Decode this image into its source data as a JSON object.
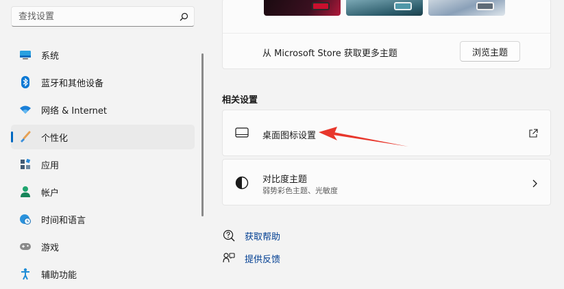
{
  "search": {
    "placeholder": "查找设置",
    "icon": "search-icon"
  },
  "sidebar": {
    "items": [
      {
        "label": "系统",
        "icon": "system-monitor-icon",
        "color": "#0078d4"
      },
      {
        "label": "蓝牙和其他设备",
        "icon": "bluetooth-icon",
        "color": "#0078d4"
      },
      {
        "label": "网络 & Internet",
        "icon": "wifi-icon",
        "color": "#0078d4"
      },
      {
        "label": "个性化",
        "icon": "brush-icon",
        "color": "#e0843c",
        "selected": true
      },
      {
        "label": "应用",
        "icon": "apps-icon",
        "color": "#4a6f8f"
      },
      {
        "label": "帐户",
        "icon": "person-icon",
        "color": "#1fa56f"
      },
      {
        "label": "时间和语言",
        "icon": "globe-clock-icon",
        "color": "#1f8dd6"
      },
      {
        "label": "游戏",
        "icon": "gamepad-icon",
        "color": "#7a7a7a"
      },
      {
        "label": "辅助功能",
        "icon": "accessibility-icon",
        "color": "#1f8dd6"
      }
    ]
  },
  "store": {
    "text": "从 Microsoft Store 获取更多主题",
    "button_label": "浏览主题"
  },
  "related": {
    "title": "相关设置",
    "cards": [
      {
        "title": "桌面图标设置",
        "icon": "desktop-icon",
        "action_icon": "external-link-icon"
      },
      {
        "title": "对比度主题",
        "subtitle": "弱势彩色主题、光敏度",
        "icon": "contrast-icon",
        "action_icon": "chevron-right-icon"
      }
    ]
  },
  "links": [
    {
      "label": "获取帮助",
      "icon": "help-icon"
    },
    {
      "label": "提供反馈",
      "icon": "feedback-icon"
    }
  ],
  "accent_color": "#0067c0",
  "annotation_arrow_color": "#e8372c"
}
